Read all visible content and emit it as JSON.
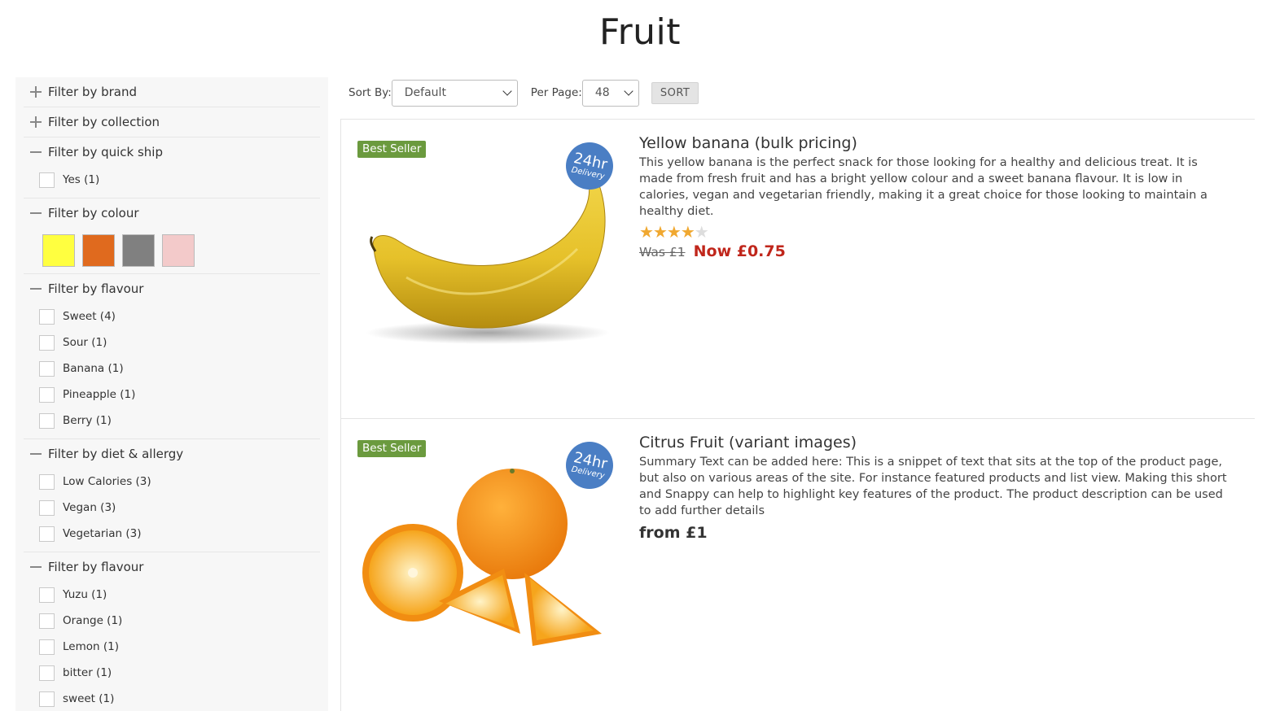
{
  "page": {
    "title": "Fruit"
  },
  "sidebar": {
    "brand": {
      "label": "Filter by brand"
    },
    "collection": {
      "label": "Filter by collection"
    },
    "quick_ship": {
      "label": "Filter by quick ship",
      "options": [
        "Yes (1)"
      ]
    },
    "colour": {
      "label": "Filter by colour",
      "swatches": [
        "#ffff40",
        "#e06a1e",
        "#808080",
        "#f3caca"
      ]
    },
    "flavour": {
      "label": "Filter by flavour",
      "options": [
        "Sweet (4)",
        "Sour (1)",
        "Banana (1)",
        "Pineapple (1)",
        "Berry (1)"
      ]
    },
    "diet": {
      "label": "Filter by diet & allergy",
      "options": [
        "Low Calories (3)",
        "Vegan (3)",
        "Vegetarian (3)"
      ]
    },
    "flavour2": {
      "label": "Filter by flavour",
      "options": [
        "Yuzu (1)",
        "Orange (1)",
        "Lemon (1)",
        "bitter (1)",
        "sweet (1)"
      ]
    }
  },
  "toolbar": {
    "sort_by_label": "Sort By:",
    "sort_by_value": "Default",
    "per_page_label": "Per Page:",
    "per_page_value": "48",
    "sort_button": "SORT"
  },
  "products": [
    {
      "badge": "Best Seller",
      "delivery_big": "24hr",
      "delivery_small": "Delivery",
      "title": "Yellow banana (bulk pricing)",
      "description": "This yellow banana is the perfect snack for those looking for a healthy and delicious treat. It is made from fresh fruit and has a bright yellow colour and a sweet banana flavour. It is low in calories, vegan and vegetarian friendly, making it a great choice for those looking to maintain a healthy diet.",
      "rating": 4,
      "rating_max": 5,
      "was_price": "Was £1",
      "now_price": "Now £0.75"
    },
    {
      "badge": "Best Seller",
      "delivery_big": "24hr",
      "delivery_small": "Delivery",
      "title": "Citrus Fruit (variant images)",
      "description": "Summary Text can be added here: This is a snippet of text that sits at the top of the product page, but also on various areas of the site. For instance featured products and list view. Making this short and Snappy can help to highlight key features of the product. The product description can be used to add further details",
      "from_price": "from £1"
    }
  ]
}
